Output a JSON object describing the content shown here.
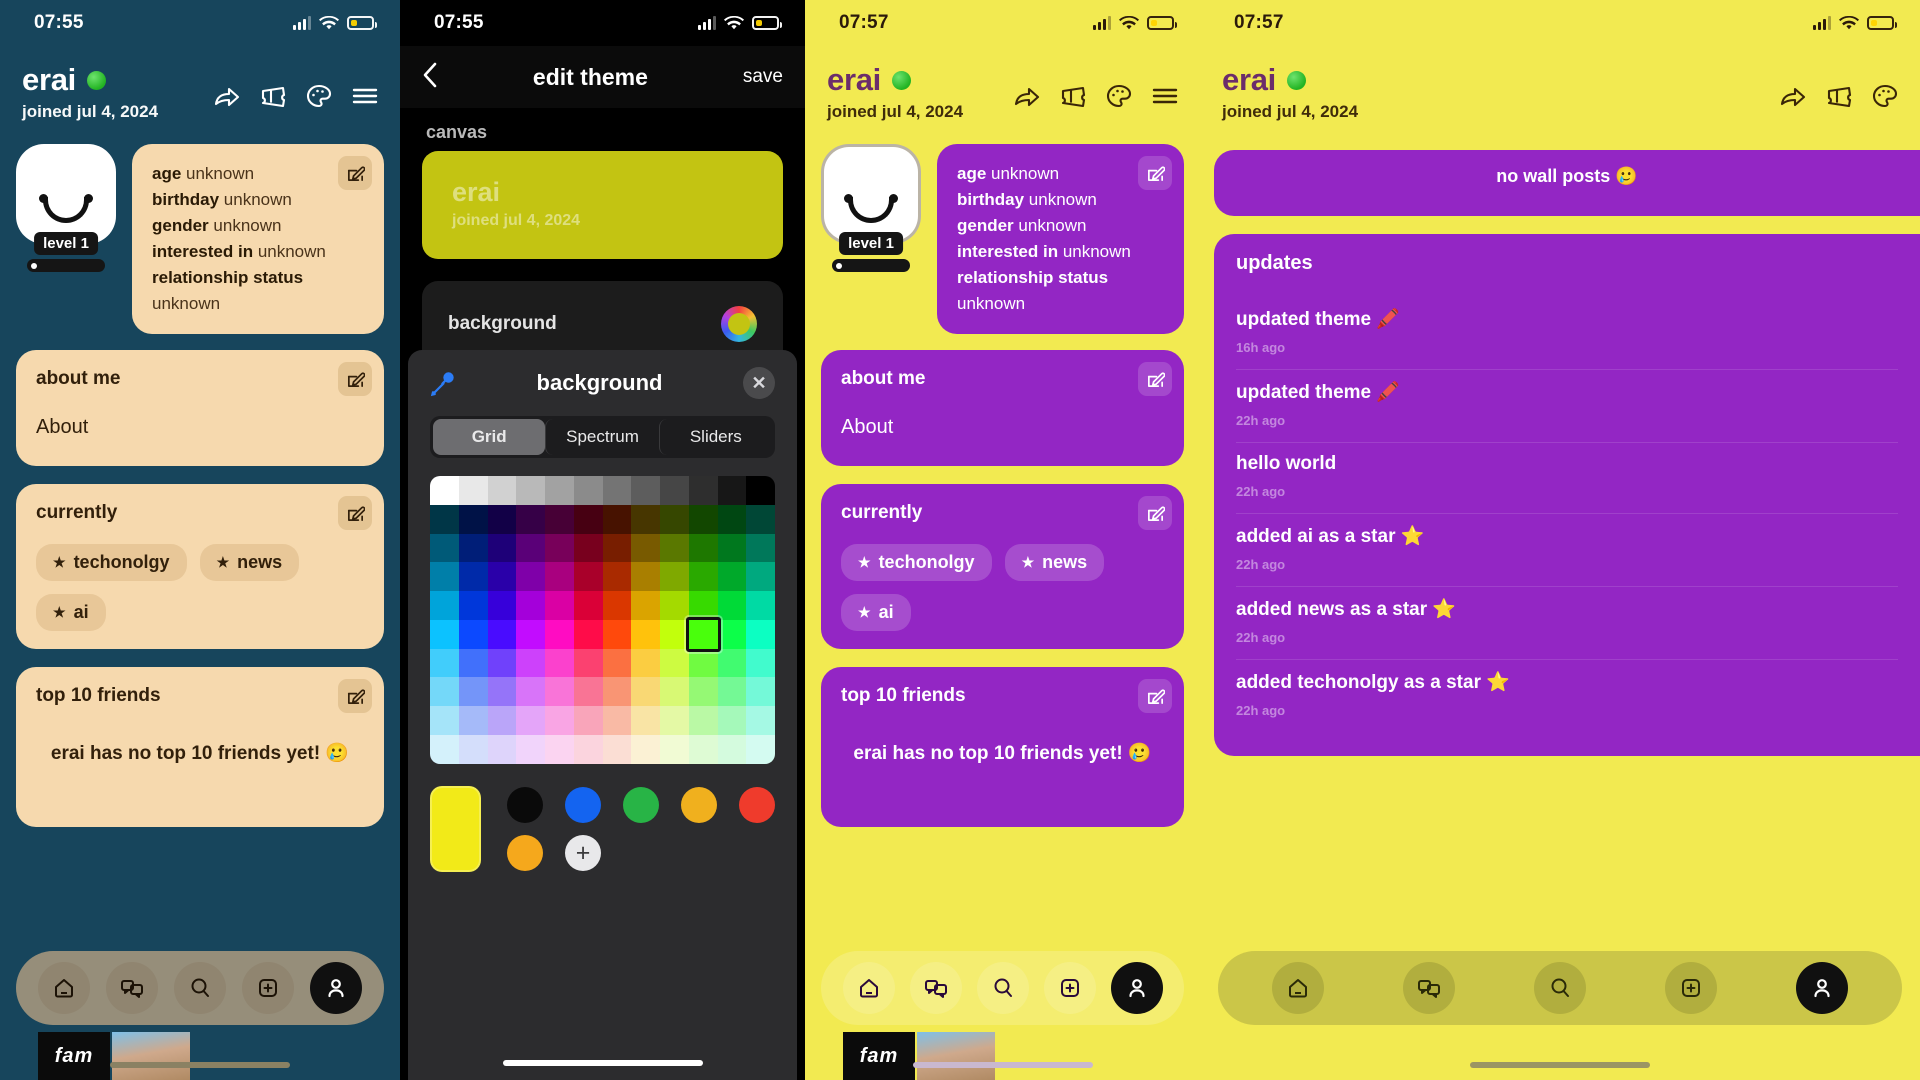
{
  "profile": {
    "username": "erai",
    "joined": "joined jul 4, 2024",
    "level": "level 1",
    "info": [
      {
        "label": "age",
        "value": "unknown"
      },
      {
        "label": "birthday",
        "value": "unknown"
      },
      {
        "label": "gender",
        "value": "unknown"
      },
      {
        "label": "interested in",
        "value": "unknown"
      },
      {
        "label": "relationship status",
        "value": "unknown"
      }
    ],
    "about": {
      "header": "about me",
      "body": "About"
    },
    "currently": {
      "header": "currently",
      "chips": [
        "techonolgy",
        "news",
        "ai"
      ]
    },
    "friends": {
      "header": "top 10 friends",
      "empty": "erai has no top 10 friends yet! 🥲"
    },
    "filmstrip": {
      "label": "fam"
    }
  },
  "panel1": {
    "status": {
      "time": "07:55"
    },
    "theme": {
      "background": "#17455c",
      "card": "#f6d9ae",
      "text": "#32200b"
    }
  },
  "panel2": {
    "status": {
      "time": "07:55"
    },
    "nav": {
      "back": "‹",
      "title": "edit theme",
      "save": "save"
    },
    "canvas_label": "canvas",
    "canvas_preview": {
      "name": "erai",
      "sub": "joined jul 4, 2024",
      "color": "#c3c412"
    },
    "background_row": {
      "label": "background",
      "color": "#c3c412"
    },
    "picker": {
      "title": "background",
      "close": "✕",
      "tabs": [
        "Grid",
        "Spectrum",
        "Sliders"
      ],
      "active_tab": "Grid",
      "selected_color": "#f2ea18",
      "recent": [
        "#0a0a0a",
        "#1464f0",
        "#28b446",
        "#f0b01e",
        "#ef3b2c"
      ],
      "recent_row2": [
        "#f5a81c"
      ],
      "add_label": "+"
    }
  },
  "panel3": {
    "status": {
      "time": "07:57"
    },
    "theme": {
      "background": "#f2ea51",
      "card": "#9326c4",
      "text": "#ffffff"
    }
  },
  "panel4": {
    "status": {
      "time": "07:57"
    },
    "wall": {
      "empty": "no wall posts 🥲"
    },
    "updates": {
      "header": "updates",
      "items": [
        {
          "title": "updated theme 🖍️",
          "time": "16h ago"
        },
        {
          "title": "updated theme 🖍️",
          "time": "22h ago"
        },
        {
          "title": "hello world",
          "time": "22h ago"
        },
        {
          "title": "added ai as a star ⭐",
          "time": "22h ago"
        },
        {
          "title": "added news as a star ⭐",
          "time": "22h ago"
        },
        {
          "title": "added techonolgy as a star ⭐",
          "time": "22h ago"
        }
      ]
    }
  },
  "nav_icons": [
    "home-icon",
    "chat-icon",
    "search-icon",
    "add-icon",
    "profile-icon"
  ],
  "header_icons": [
    "share-icon",
    "ticket-icon",
    "palette-icon",
    "menu-icon"
  ]
}
